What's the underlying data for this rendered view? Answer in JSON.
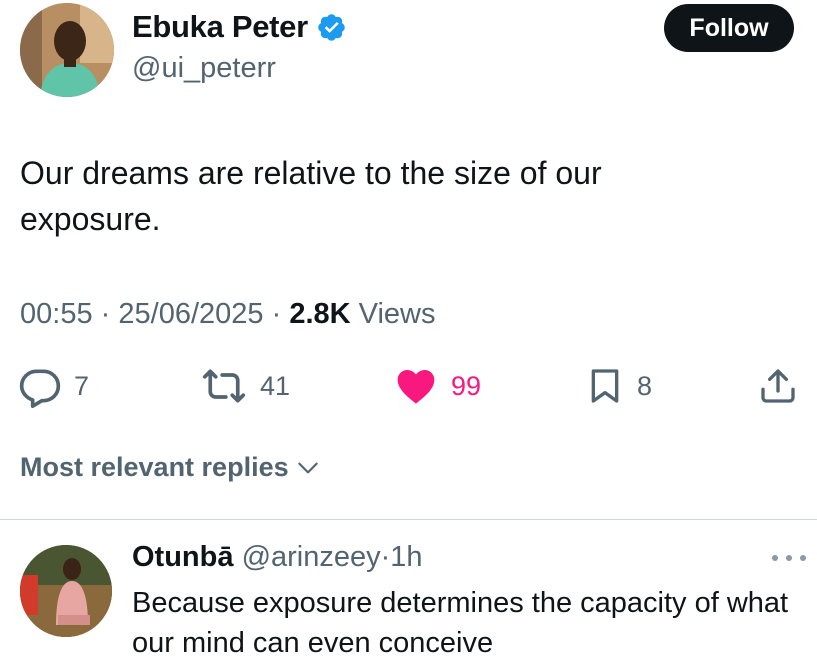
{
  "post": {
    "author": {
      "name": "Ebuka Peter",
      "handle": "@ui_peterr",
      "verified": true,
      "avatar_icon": "profile-photo"
    },
    "follow_label": "Follow",
    "text": "Our dreams are relative to the size of our exposure.",
    "time": "00:55",
    "separator": "·",
    "date": "25/06/2025",
    "views_count": "2.8K",
    "views_label": "Views",
    "actions": {
      "reply": {
        "icon": "reply-icon",
        "count": "7"
      },
      "retweet": {
        "icon": "retweet-icon",
        "count": "41"
      },
      "like": {
        "icon": "heart-icon",
        "count": "99",
        "liked": true
      },
      "bookmark": {
        "icon": "bookmark-icon",
        "count": "8"
      },
      "share": {
        "icon": "share-icon"
      }
    }
  },
  "replies_sort_label": "Most relevant replies",
  "reply": {
    "name": "Otunbā",
    "handle": "@arinzeey",
    "separator": "·",
    "time": "1h",
    "text": "Because exposure determines the capacity of what our mind can even conceive",
    "avatar_icon": "profile-photo"
  },
  "colors": {
    "text_primary": "#0f1419",
    "text_secondary": "#536471",
    "verified_blue": "#1d9bf0",
    "like_pink": "#f91880",
    "follow_button": "#0f1419",
    "divider": "#cfd9de"
  }
}
